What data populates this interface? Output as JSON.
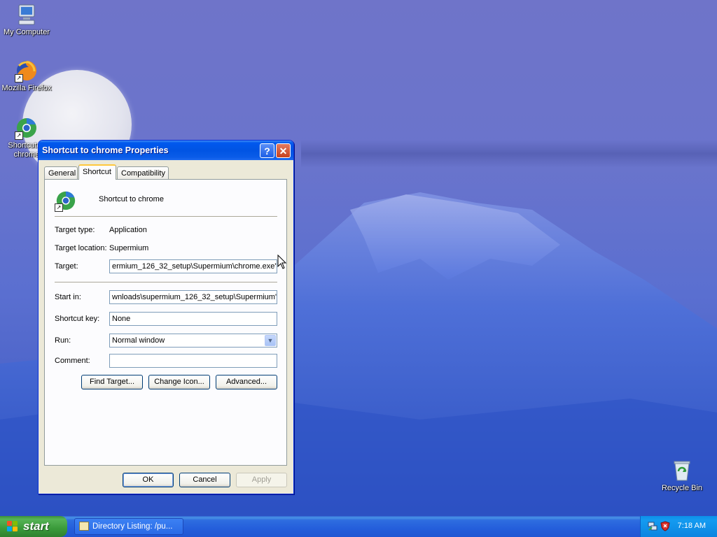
{
  "desktop": {
    "icons": [
      {
        "label": "My Computer",
        "icon": "my-computer-icon"
      },
      {
        "label": "Mozilla Firefox",
        "icon": "firefox-icon"
      },
      {
        "label": "Shortcut to chrome",
        "icon": "chrome-icon"
      },
      {
        "label": "Recycle Bin",
        "icon": "recycle-bin-icon"
      }
    ]
  },
  "dialog": {
    "title": "Shortcut to chrome Properties",
    "help_glyph": "?",
    "close_glyph": "✕",
    "tabs": [
      {
        "label": "General",
        "active": false
      },
      {
        "label": "Shortcut",
        "active": true
      },
      {
        "label": "Compatibility",
        "active": false
      }
    ],
    "shortcut_name": "Shortcut to chrome",
    "target_type_label": "Target type:",
    "target_type_value": "Application",
    "target_location_label": "Target location:",
    "target_location_value": "Supermium",
    "target_label": "Target:",
    "target_value": "ermium_126_32_setup\\Supermium\\chrome.exe\"",
    "start_in_label": "Start in:",
    "start_in_value": "wnloads\\supermium_126_32_setup\\Supermium\"",
    "shortcut_key_label": "Shortcut key:",
    "shortcut_key_value": "None",
    "run_label": "Run:",
    "run_value": "Normal window",
    "comment_label": "Comment:",
    "comment_value": "",
    "find_target_label": "Find Target...",
    "change_icon_label": "Change Icon...",
    "advanced_label": "Advanced...",
    "ok_label": "OK",
    "cancel_label": "Cancel",
    "apply_label": "Apply"
  },
  "taskbar": {
    "start_label": "start",
    "task_item_label": "Directory Listing: /pu...",
    "clock": "7:18 AM"
  },
  "colors": {
    "titlebar": "#0054e3",
    "taskbar": "#245edb",
    "start": "#3a9a3a",
    "dialog_bg": "#ece9d8"
  }
}
